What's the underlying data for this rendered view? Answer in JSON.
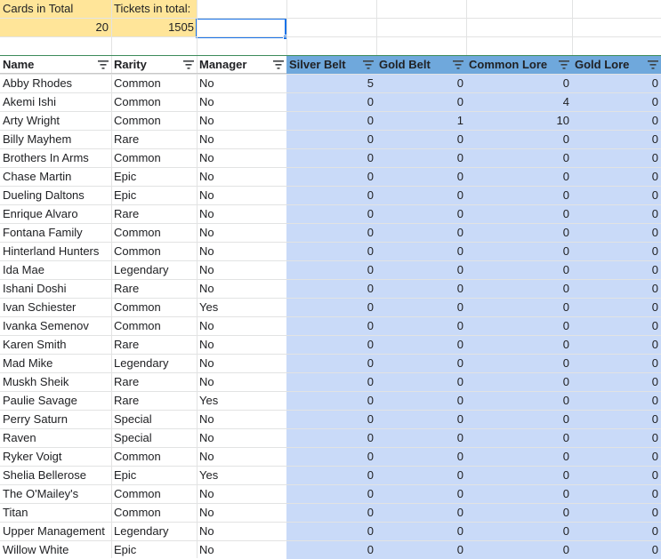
{
  "summary": {
    "cards_label": "Cards in Total",
    "cards_value": "20",
    "tickets_label": "Tickets in total:",
    "tickets_value": "1505"
  },
  "headers": [
    "Name",
    "Rarity",
    "Manager",
    "Silver Belt",
    "Gold Belt",
    "Common Lore",
    "Gold Lore"
  ],
  "rows": [
    [
      "Abby Rhodes",
      "Common",
      "No",
      "5",
      "0",
      "0",
      "0"
    ],
    [
      "Akemi Ishi",
      "Common",
      "No",
      "0",
      "0",
      "4",
      "0"
    ],
    [
      "Arty Wright",
      "Common",
      "No",
      "0",
      "1",
      "10",
      "0"
    ],
    [
      "Billy Mayhem",
      "Rare",
      "No",
      "0",
      "0",
      "0",
      "0"
    ],
    [
      "Brothers In Arms",
      "Common",
      "No",
      "0",
      "0",
      "0",
      "0"
    ],
    [
      "Chase Martin",
      "Epic",
      "No",
      "0",
      "0",
      "0",
      "0"
    ],
    [
      "Dueling Daltons",
      "Epic",
      "No",
      "0",
      "0",
      "0",
      "0"
    ],
    [
      "Enrique Alvaro",
      "Rare",
      "No",
      "0",
      "0",
      "0",
      "0"
    ],
    [
      "Fontana Family",
      "Common",
      "No",
      "0",
      "0",
      "0",
      "0"
    ],
    [
      "Hinterland Hunters",
      "Common",
      "No",
      "0",
      "0",
      "0",
      "0"
    ],
    [
      "Ida Mae",
      "Legendary",
      "No",
      "0",
      "0",
      "0",
      "0"
    ],
    [
      "Ishani Doshi",
      "Rare",
      "No",
      "0",
      "0",
      "0",
      "0"
    ],
    [
      "Ivan Schiester",
      "Common",
      "Yes",
      "0",
      "0",
      "0",
      "0"
    ],
    [
      "Ivanka Semenov",
      "Common",
      "No",
      "0",
      "0",
      "0",
      "0"
    ],
    [
      "Karen Smith",
      "Rare",
      "No",
      "0",
      "0",
      "0",
      "0"
    ],
    [
      "Mad Mike",
      "Legendary",
      "No",
      "0",
      "0",
      "0",
      "0"
    ],
    [
      "Muskh Sheik",
      "Rare",
      "No",
      "0",
      "0",
      "0",
      "0"
    ],
    [
      "Paulie Savage",
      "Rare",
      "Yes",
      "0",
      "0",
      "0",
      "0"
    ],
    [
      "Perry Saturn",
      "Special",
      "No",
      "0",
      "0",
      "0",
      "0"
    ],
    [
      "Raven",
      "Special",
      "No",
      "0",
      "0",
      "0",
      "0"
    ],
    [
      "Ryker Voigt",
      "Common",
      "No",
      "0",
      "0",
      "0",
      "0"
    ],
    [
      "Shelia Bellerose",
      "Epic",
      "Yes",
      "0",
      "0",
      "0",
      "0"
    ],
    [
      "The O'Mailey's",
      "Common",
      "No",
      "0",
      "0",
      "0",
      "0"
    ],
    [
      "Titan",
      "Common",
      "No",
      "0",
      "0",
      "0",
      "0"
    ],
    [
      "Upper Management",
      "Legendary",
      "No",
      "0",
      "0",
      "0",
      "0"
    ],
    [
      "Willow White",
      "Epic",
      "No",
      "0",
      "0",
      "0",
      "0"
    ]
  ],
  "colors": {
    "summary_fill": "#ffe599",
    "header_blue": "#6fa8dc",
    "data_blue": "#c9daf8",
    "selection": "#1a73e8"
  },
  "icons": {
    "filter": "filter-icon"
  }
}
